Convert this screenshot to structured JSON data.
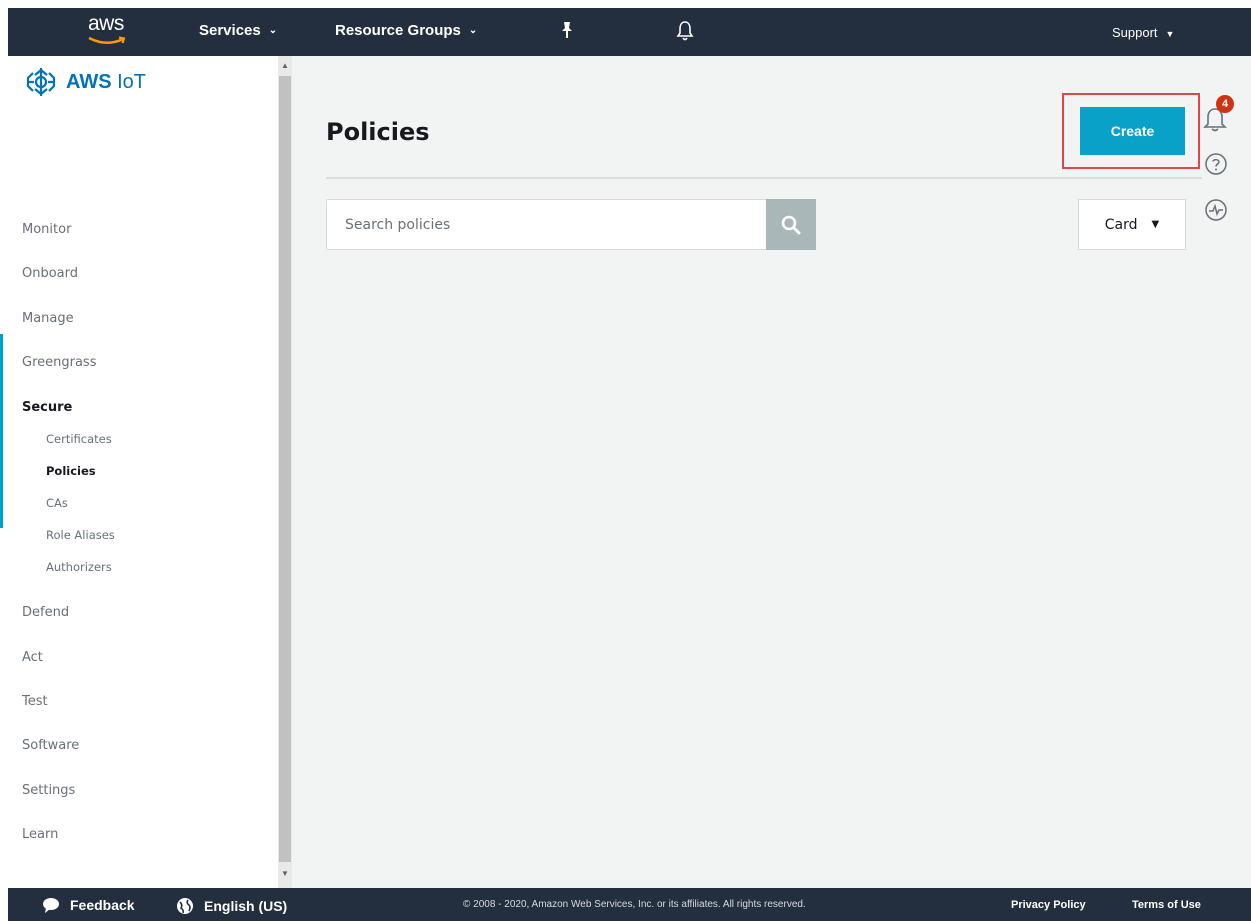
{
  "topnav": {
    "logo_text": "aws",
    "services_label": "Services",
    "resource_groups_label": "Resource Groups",
    "support_label": "Support",
    "pin_icon": "pin-icon",
    "bell_icon": "bell-icon"
  },
  "sidebar": {
    "brand_prefix": "AWS",
    "brand_suffix": "IoT",
    "items": [
      {
        "label": "Monitor"
      },
      {
        "label": "Onboard"
      },
      {
        "label": "Manage"
      },
      {
        "label": "Greengrass"
      },
      {
        "label": "Secure",
        "active": true
      },
      {
        "label": "Defend"
      },
      {
        "label": "Act"
      },
      {
        "label": "Test"
      },
      {
        "label": "Software"
      },
      {
        "label": "Settings"
      },
      {
        "label": "Learn"
      }
    ],
    "secure_subitems": [
      {
        "label": "Certificates"
      },
      {
        "label": "Policies",
        "active": true
      },
      {
        "label": "CAs"
      },
      {
        "label": "Role Aliases"
      },
      {
        "label": "Authorizers"
      }
    ]
  },
  "main": {
    "title": "Policies",
    "create_label": "Create",
    "search_placeholder": "Search policies",
    "view_mode": "Card"
  },
  "right_rail": {
    "notifications_count": "4"
  },
  "footer": {
    "feedback_label": "Feedback",
    "language_label": "English (US)",
    "copyright": "© 2008 - 2020, Amazon Web Services, Inc. or its affiliates. All rights reserved.",
    "privacy_label": "Privacy Policy",
    "terms_label": "Terms of Use"
  },
  "colors": {
    "nav_bg": "#232f3e",
    "accent": "#0aa1c9",
    "highlight": "#e0474c",
    "badge": "#d13212"
  }
}
